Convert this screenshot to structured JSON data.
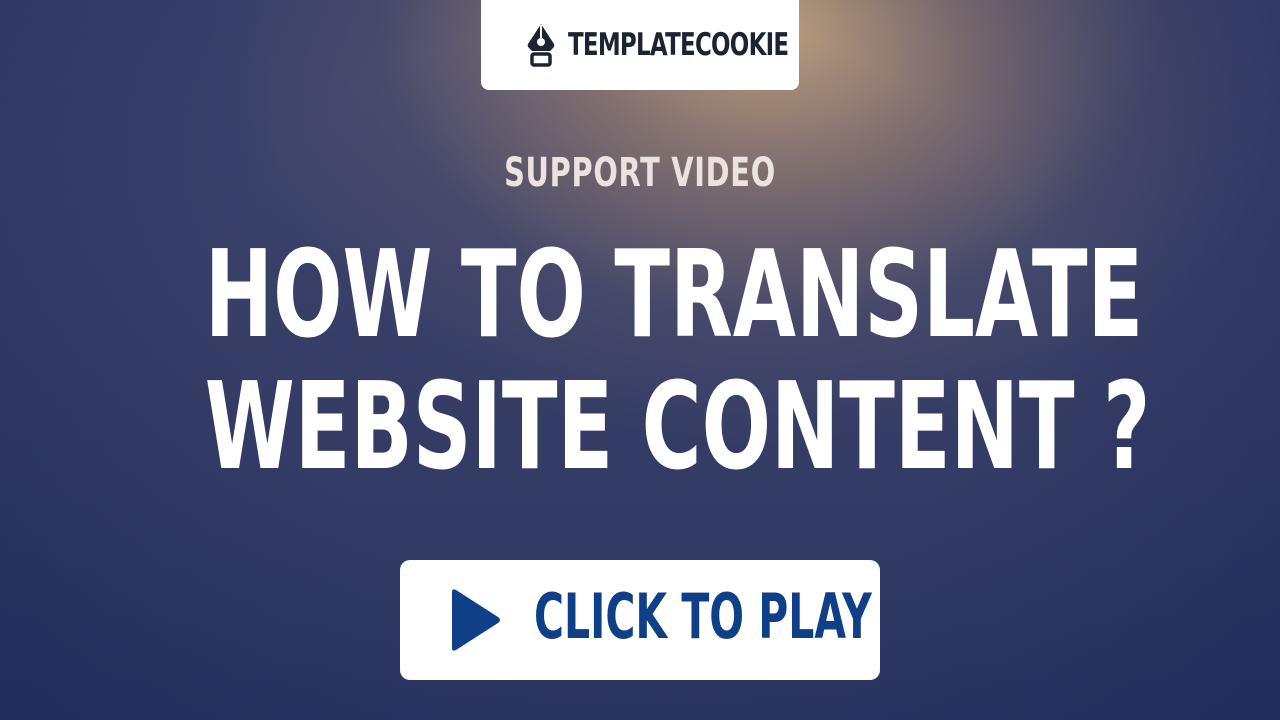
{
  "logo": {
    "icon": "pen-nib-icon",
    "text": "TEMPLATECOOKIE"
  },
  "subtitle": "SUPPORT VIDEO",
  "headline": {
    "line1": "HOW TO TRANSLATE",
    "line2": "WEBSITE CONTENT ?"
  },
  "play_button": {
    "icon": "play-icon",
    "label": "CLICK TO PLAY"
  },
  "colors": {
    "brand_dark": "#1c2333",
    "button_text": "#0f3f86",
    "headline": "#ffffff",
    "subtitle": "#ece3de"
  }
}
